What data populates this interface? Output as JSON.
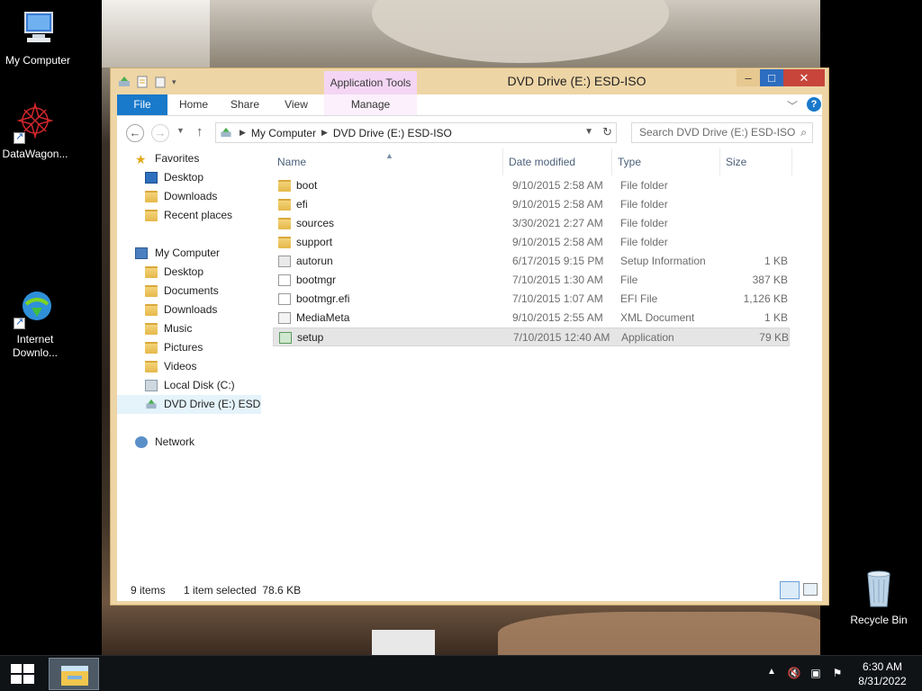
{
  "desktop": {
    "icons": [
      {
        "label": "My Computer",
        "icon": "computer-icon"
      },
      {
        "label": "DataWagon...",
        "icon": "datawagon-icon"
      },
      {
        "label": "Internet\nDownlo...",
        "label_line1": "Internet",
        "label_line2": "Downlo...",
        "icon": "internet-download-manager-icon"
      },
      {
        "label": "Recycle Bin",
        "icon": "recycle-bin-icon"
      }
    ]
  },
  "window": {
    "title": "DVD Drive (E:) ESD-ISO",
    "context_tab": "Application Tools",
    "caption_buttons": {
      "minimize": "–",
      "maximize": "□",
      "close": "✕"
    },
    "accent_color": "#1979ca",
    "ribbon_tabs": [
      "File",
      "Home",
      "Share",
      "View",
      "Manage"
    ],
    "address": {
      "segments": [
        "My Computer",
        "DVD Drive (E:) ESD-ISO"
      ]
    },
    "search": {
      "placeholder": "Search DVD Drive (E:) ESD-ISO"
    },
    "nav_pane": {
      "favorites": {
        "label": "Favorites",
        "items": [
          "Desktop",
          "Downloads",
          "Recent places"
        ]
      },
      "computer": {
        "label": "My Computer",
        "items": [
          "Desktop",
          "Documents",
          "Downloads",
          "Music",
          "Pictures",
          "Videos",
          "Local Disk (C:)",
          "DVD Drive (E:) ESD-IS"
        ]
      },
      "network": {
        "label": "Network"
      }
    },
    "columns": [
      "Name",
      "Date modified",
      "Type",
      "Size"
    ],
    "files": [
      {
        "name": "boot",
        "date": "9/10/2015 2:58 AM",
        "type": "File folder",
        "size": "",
        "kind": "folder"
      },
      {
        "name": "efi",
        "date": "9/10/2015 2:58 AM",
        "type": "File folder",
        "size": "",
        "kind": "folder"
      },
      {
        "name": "sources",
        "date": "3/30/2021 2:27 AM",
        "type": "File folder",
        "size": "",
        "kind": "folder"
      },
      {
        "name": "support",
        "date": "9/10/2015 2:58 AM",
        "type": "File folder",
        "size": "",
        "kind": "folder"
      },
      {
        "name": "autorun",
        "date": "6/17/2015 9:15 PM",
        "type": "Setup Information",
        "size": "1 KB",
        "kind": "setup-info"
      },
      {
        "name": "bootmgr",
        "date": "7/10/2015 1:30 AM",
        "type": "File",
        "size": "387 KB",
        "kind": "file"
      },
      {
        "name": "bootmgr.efi",
        "date": "7/10/2015 1:07 AM",
        "type": "EFI File",
        "size": "1,126 KB",
        "kind": "file"
      },
      {
        "name": "MediaMeta",
        "date": "9/10/2015 2:55 AM",
        "type": "XML Document",
        "size": "1 KB",
        "kind": "xml"
      },
      {
        "name": "setup",
        "date": "7/10/2015 12:40 AM",
        "type": "Application",
        "size": "79 KB",
        "kind": "application",
        "selected": true
      }
    ],
    "status": {
      "count": "9 items",
      "selection": "1 item selected  78.6 KB"
    }
  },
  "taskbar": {
    "time": "6:30 AM",
    "date": "8/31/2022"
  }
}
